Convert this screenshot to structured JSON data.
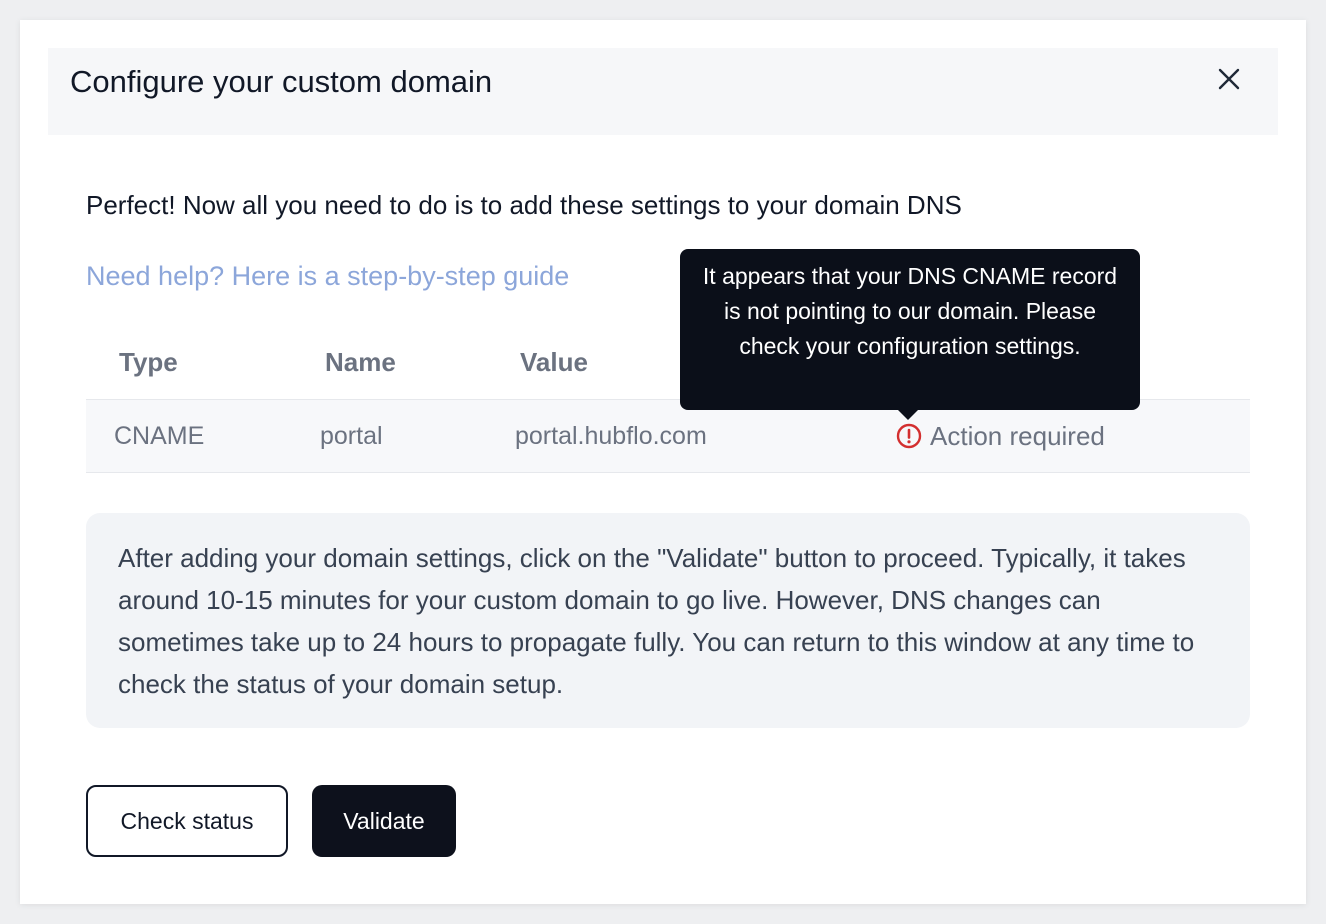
{
  "dialog": {
    "title": "Configure your custom domain",
    "close_icon": "close-icon"
  },
  "intro_text": "Perfect! Now all you need to do is to add these settings to your domain DNS",
  "help_link": "Need help? Here is a step-by-step guide",
  "table": {
    "headers": [
      "Type",
      "Name",
      "Value"
    ],
    "rows": [
      {
        "type": "CNAME",
        "name": "portal",
        "value": "portal.hubflo.com",
        "status": "Action required",
        "status_icon": "alert-circle-icon"
      }
    ]
  },
  "tooltip": "It appears that your DNS CNAME record is not pointing to our domain. Please check your configuration settings.",
  "info_text": "After adding your domain settings, click on the \"Validate\" button to proceed. Typically, it takes around 10-15 minutes for your custom domain to go live. However, DNS changes can sometimes take up to 24 hours to propagate fully. You can return to this window at any time to check the status of your domain setup.",
  "buttons": {
    "check_status": "Check status",
    "validate": "Validate"
  },
  "colors": {
    "link": "#8ca6da",
    "error": "#d32f2f",
    "primary": "#0d111c"
  }
}
